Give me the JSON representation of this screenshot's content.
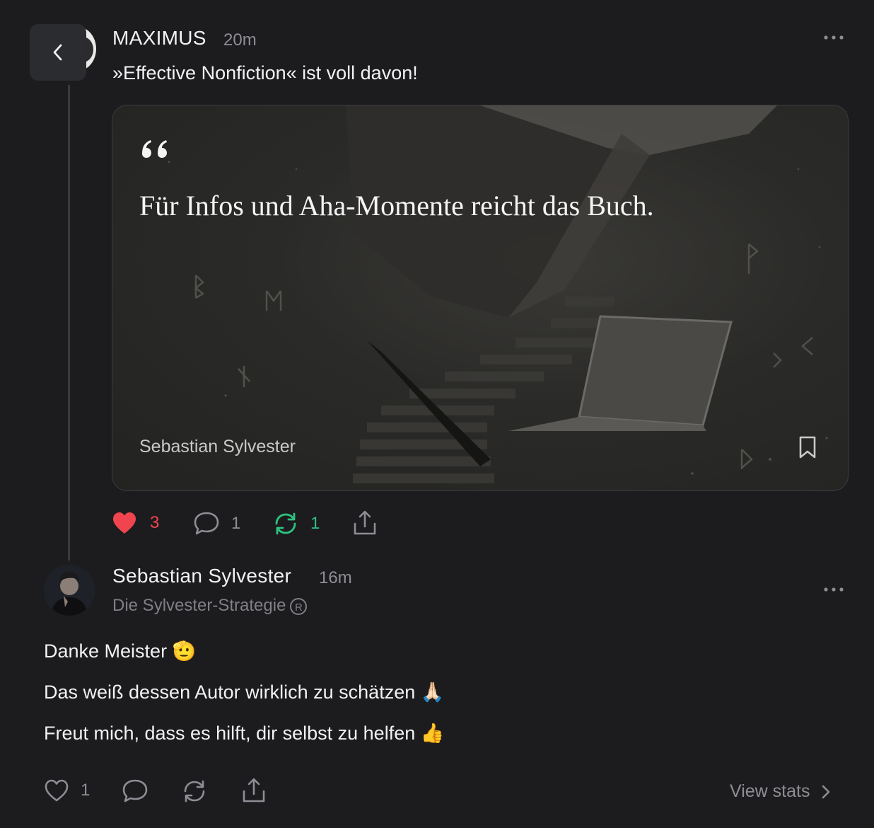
{
  "post": {
    "author": "MAXIMUS",
    "time": "20m",
    "text": "»Effective Nonfiction« ist voll davon!",
    "quote": {
      "text": "Für Infos und Aha-Momente reicht das Buch.",
      "author": "Sebastian Sylvester"
    },
    "actions": {
      "likes": "3",
      "comments": "1",
      "restacks": "1"
    }
  },
  "reply": {
    "author": "Sebastian Sylvester",
    "time": "16m",
    "publication": "Die Sylvester-Strategie",
    "registered_mark": "R",
    "lines": [
      "Danke Meister 🫡",
      "Das weiß dessen Autor wirklich zu schätzen 🙏🏻",
      "Freut mich, dass es hilft, dir selbst zu helfen 👍"
    ],
    "actions": {
      "likes": "1"
    },
    "view_stats": "View stats"
  },
  "colors": {
    "background": "#1c1c1f",
    "like_active": "#f0454f",
    "restack_active": "#2ec27e",
    "muted": "#8d8e93"
  },
  "icons": [
    "back-icon",
    "more-icon",
    "quote-mark-icon",
    "bookmark-icon",
    "heart-icon",
    "comment-icon",
    "restack-icon",
    "share-icon",
    "chevron-right-icon"
  ]
}
